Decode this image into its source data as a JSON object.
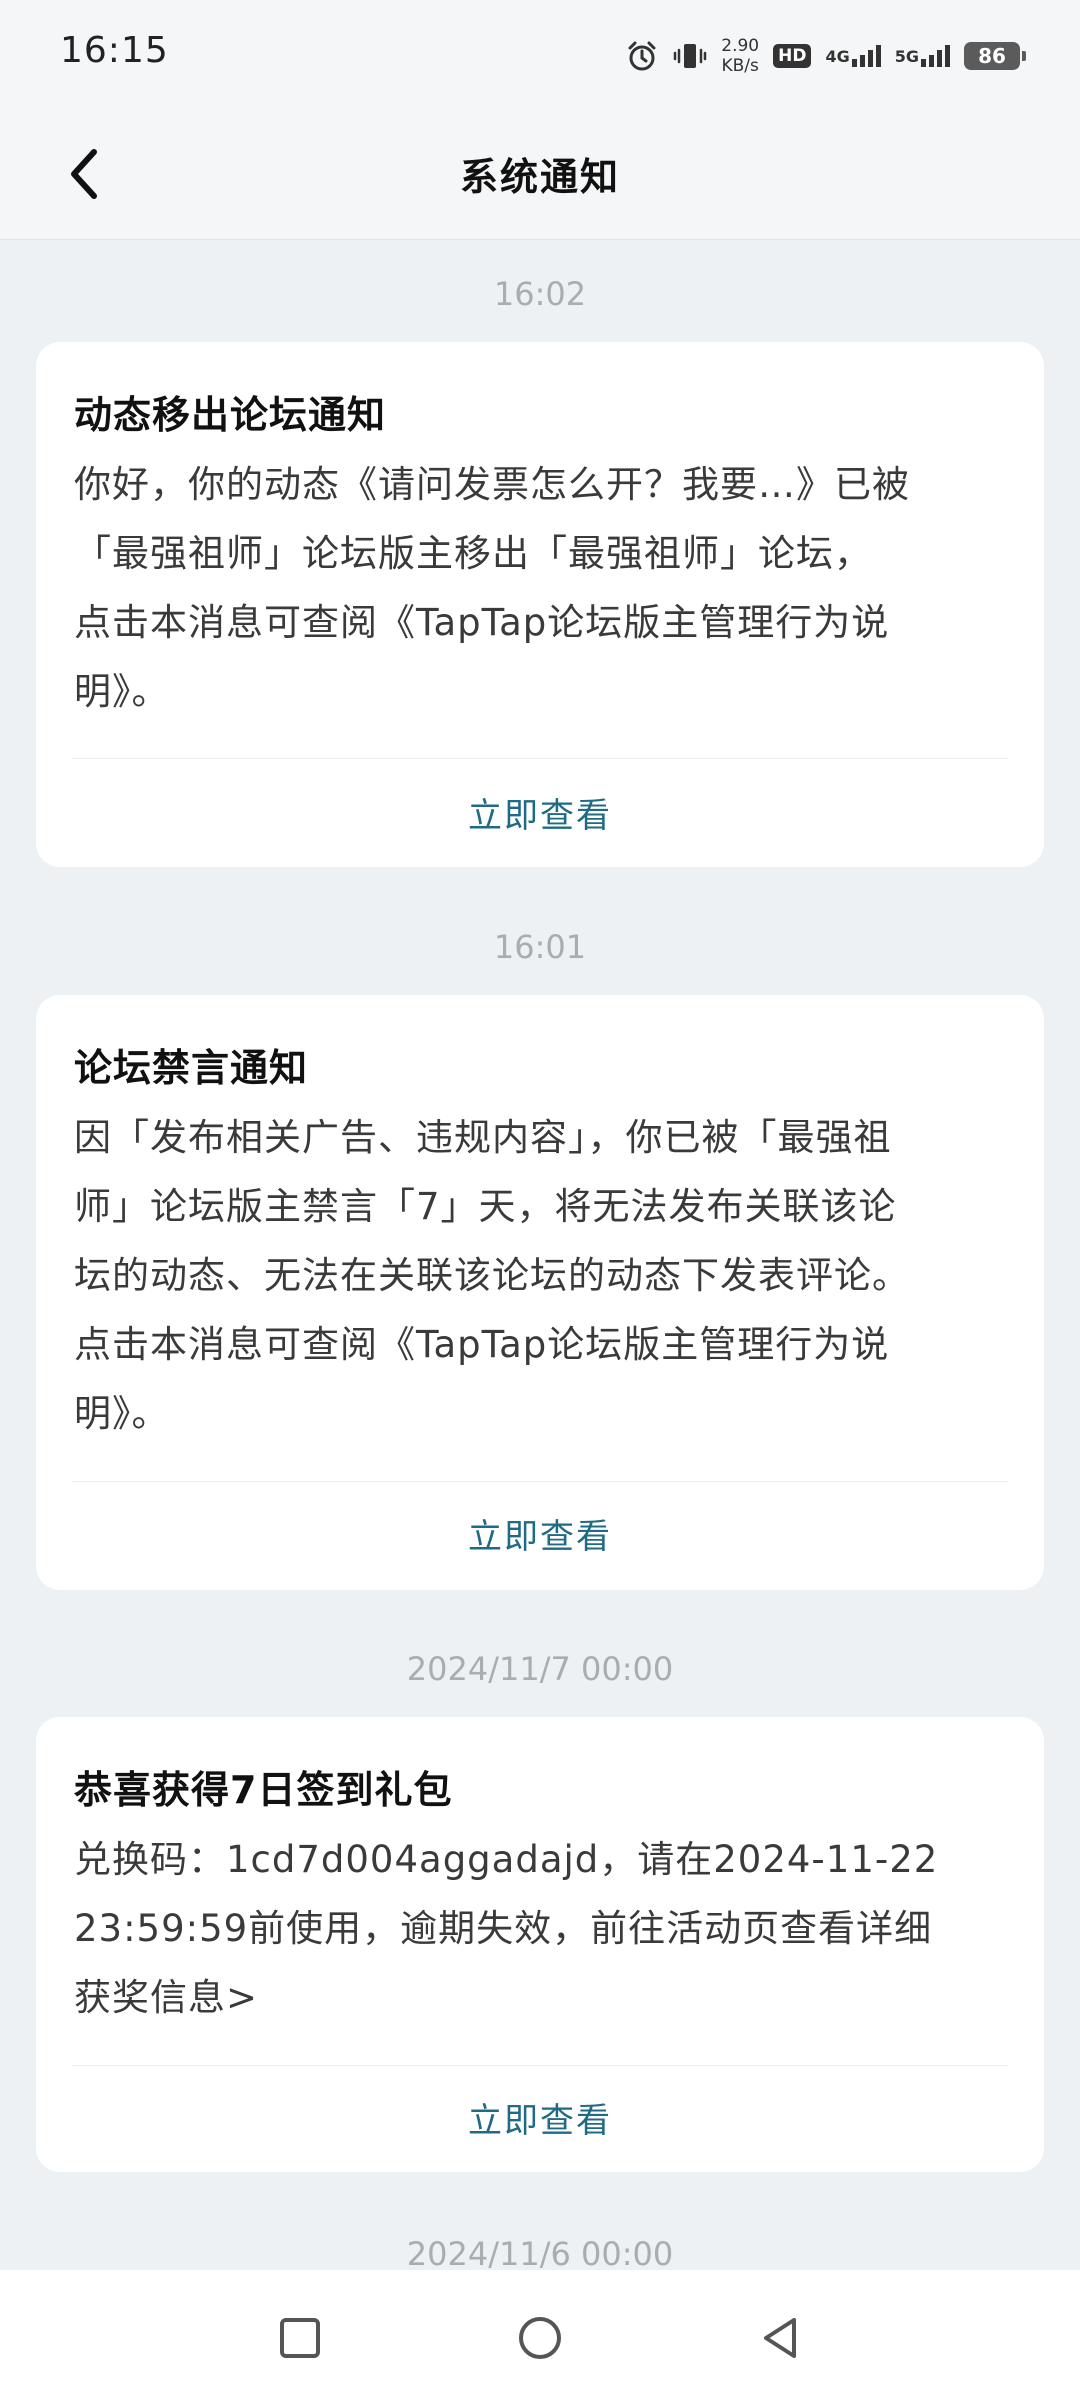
{
  "status_bar": {
    "time": "16:15",
    "net_speed_value": "2.90",
    "net_speed_unit": "KB/s",
    "hd_badge": "HD",
    "signal_1_label": "4G",
    "signal_2_label": "5G",
    "battery": "86",
    "icons": [
      "alarm-icon",
      "vibrate-icon"
    ]
  },
  "header": {
    "title": "系统通知"
  },
  "notifications": [
    {
      "time": "16:02",
      "title": "动态移出论坛通知",
      "body_lines": [
        "你好，你的动态《请问发票怎么开？我要…》已被",
        "「最强祖师」论坛版主移出「最强祖师」论坛，",
        "点击本消息可查阅《TapTap论坛版主管理行为说",
        "明》。"
      ],
      "action": "立即查看"
    },
    {
      "time": "16:01",
      "title": "论坛禁言通知",
      "body_lines": [
        "因「发布相关广告、违规内容」，你已被「最强祖",
        "师」论坛版主禁言「7」天，将无法发布关联该论",
        "坛的动态、无法在关联该论坛的动态下发表评论。",
        "点击本消息可查阅《TapTap论坛版主管理行为说",
        "明》。"
      ],
      "action": "立即查看"
    },
    {
      "time": "2024/11/7  00:00",
      "title": "恭喜获得7日签到礼包",
      "body_lines": [
        "兑换码：1cd7d004aggadajd，请在2024-11-22",
        "23:59:59前使用，逾期失效，前往活动页查看详细",
        "获奖信息>"
      ],
      "action": "立即查看"
    },
    {
      "time": "2024/11/6  00:00"
    }
  ],
  "nav_bar": {
    "buttons": [
      "recents-square-icon",
      "home-circle-icon",
      "back-triangle-icon"
    ]
  },
  "colors": {
    "background": "#eef1f3",
    "card": "#ffffff",
    "accent": "#1f6a84",
    "timestamp": "#a9adb1"
  }
}
